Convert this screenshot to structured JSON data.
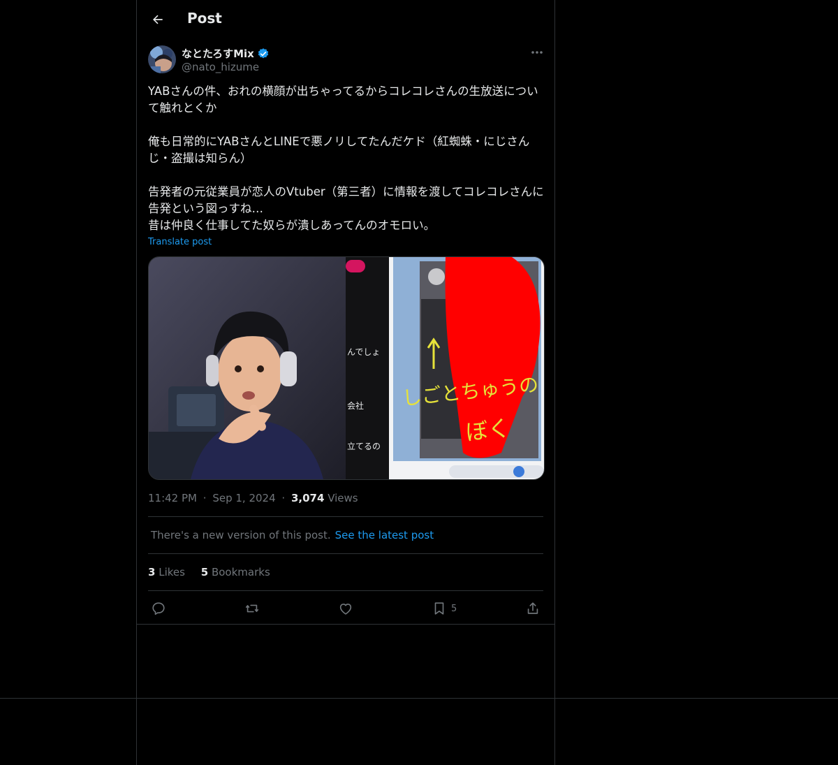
{
  "header": {
    "title": "Post"
  },
  "author": {
    "display_name": "なとたろすMix",
    "handle": "@nato_hizume"
  },
  "post": {
    "paragraphs": [
      "YABさんの件、おれの横顔が出ちゃってるからコレコレさんの生放送について触れとくか",
      "俺も日常的にYABさんとLINEで悪ノリしてたんだケド（紅蜘蛛・にじさんじ・盗撮は知らん）",
      "告発者の元従業員が恋人のVtuber（第三者）に情報を渡してコレコレさんに告発という図っすね…",
      "昔は仲良く仕事してた奴らが潰しあってんのオモロい。"
    ],
    "translate_label": "Translate post"
  },
  "media": {
    "chat_lines": [
      "んでしょ",
      "会社",
      "立てるの"
    ],
    "handwriting_top": "しごとちゅうの",
    "handwriting_bottom": "ぼく"
  },
  "meta": {
    "time": "11:42 PM",
    "date": "Sep 1, 2024",
    "views_count": "3,074",
    "views_label": "Views",
    "separator": "·"
  },
  "notice": {
    "text": "There's a new version of this post.",
    "link": "See the latest post"
  },
  "stats": {
    "likes_count": "3",
    "likes_label": "Likes",
    "bookmarks_count": "5",
    "bookmarks_label": "Bookmarks"
  },
  "actions": {
    "bookmark_count": "5"
  },
  "colors": {
    "accent": "#1d9bf0",
    "background": "#000000",
    "border": "#2f3336",
    "muted": "#71767b"
  }
}
